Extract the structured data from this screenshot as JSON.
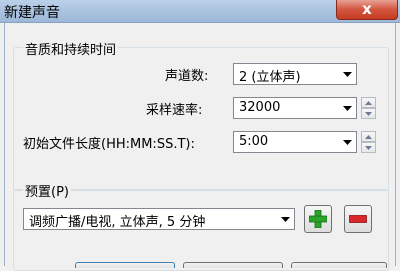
{
  "window": {
    "title": "新建声音",
    "close_label": "x"
  },
  "quality_group": {
    "title": "音质和持续时间",
    "channels": {
      "label": "声道数:",
      "value": "2 (立体声)"
    },
    "sample_rate": {
      "label": "采样速率:",
      "value": "32000"
    },
    "initial_length": {
      "label": "初始文件长度(HH:MM:SS.T):",
      "value": "5:00"
    }
  },
  "preset_group": {
    "title": "预置(P)",
    "value": "调频广播/电视, 立体声, 5 分钟"
  },
  "colors": {
    "add_green": "#2aa52a",
    "remove_red": "#d9262a"
  }
}
